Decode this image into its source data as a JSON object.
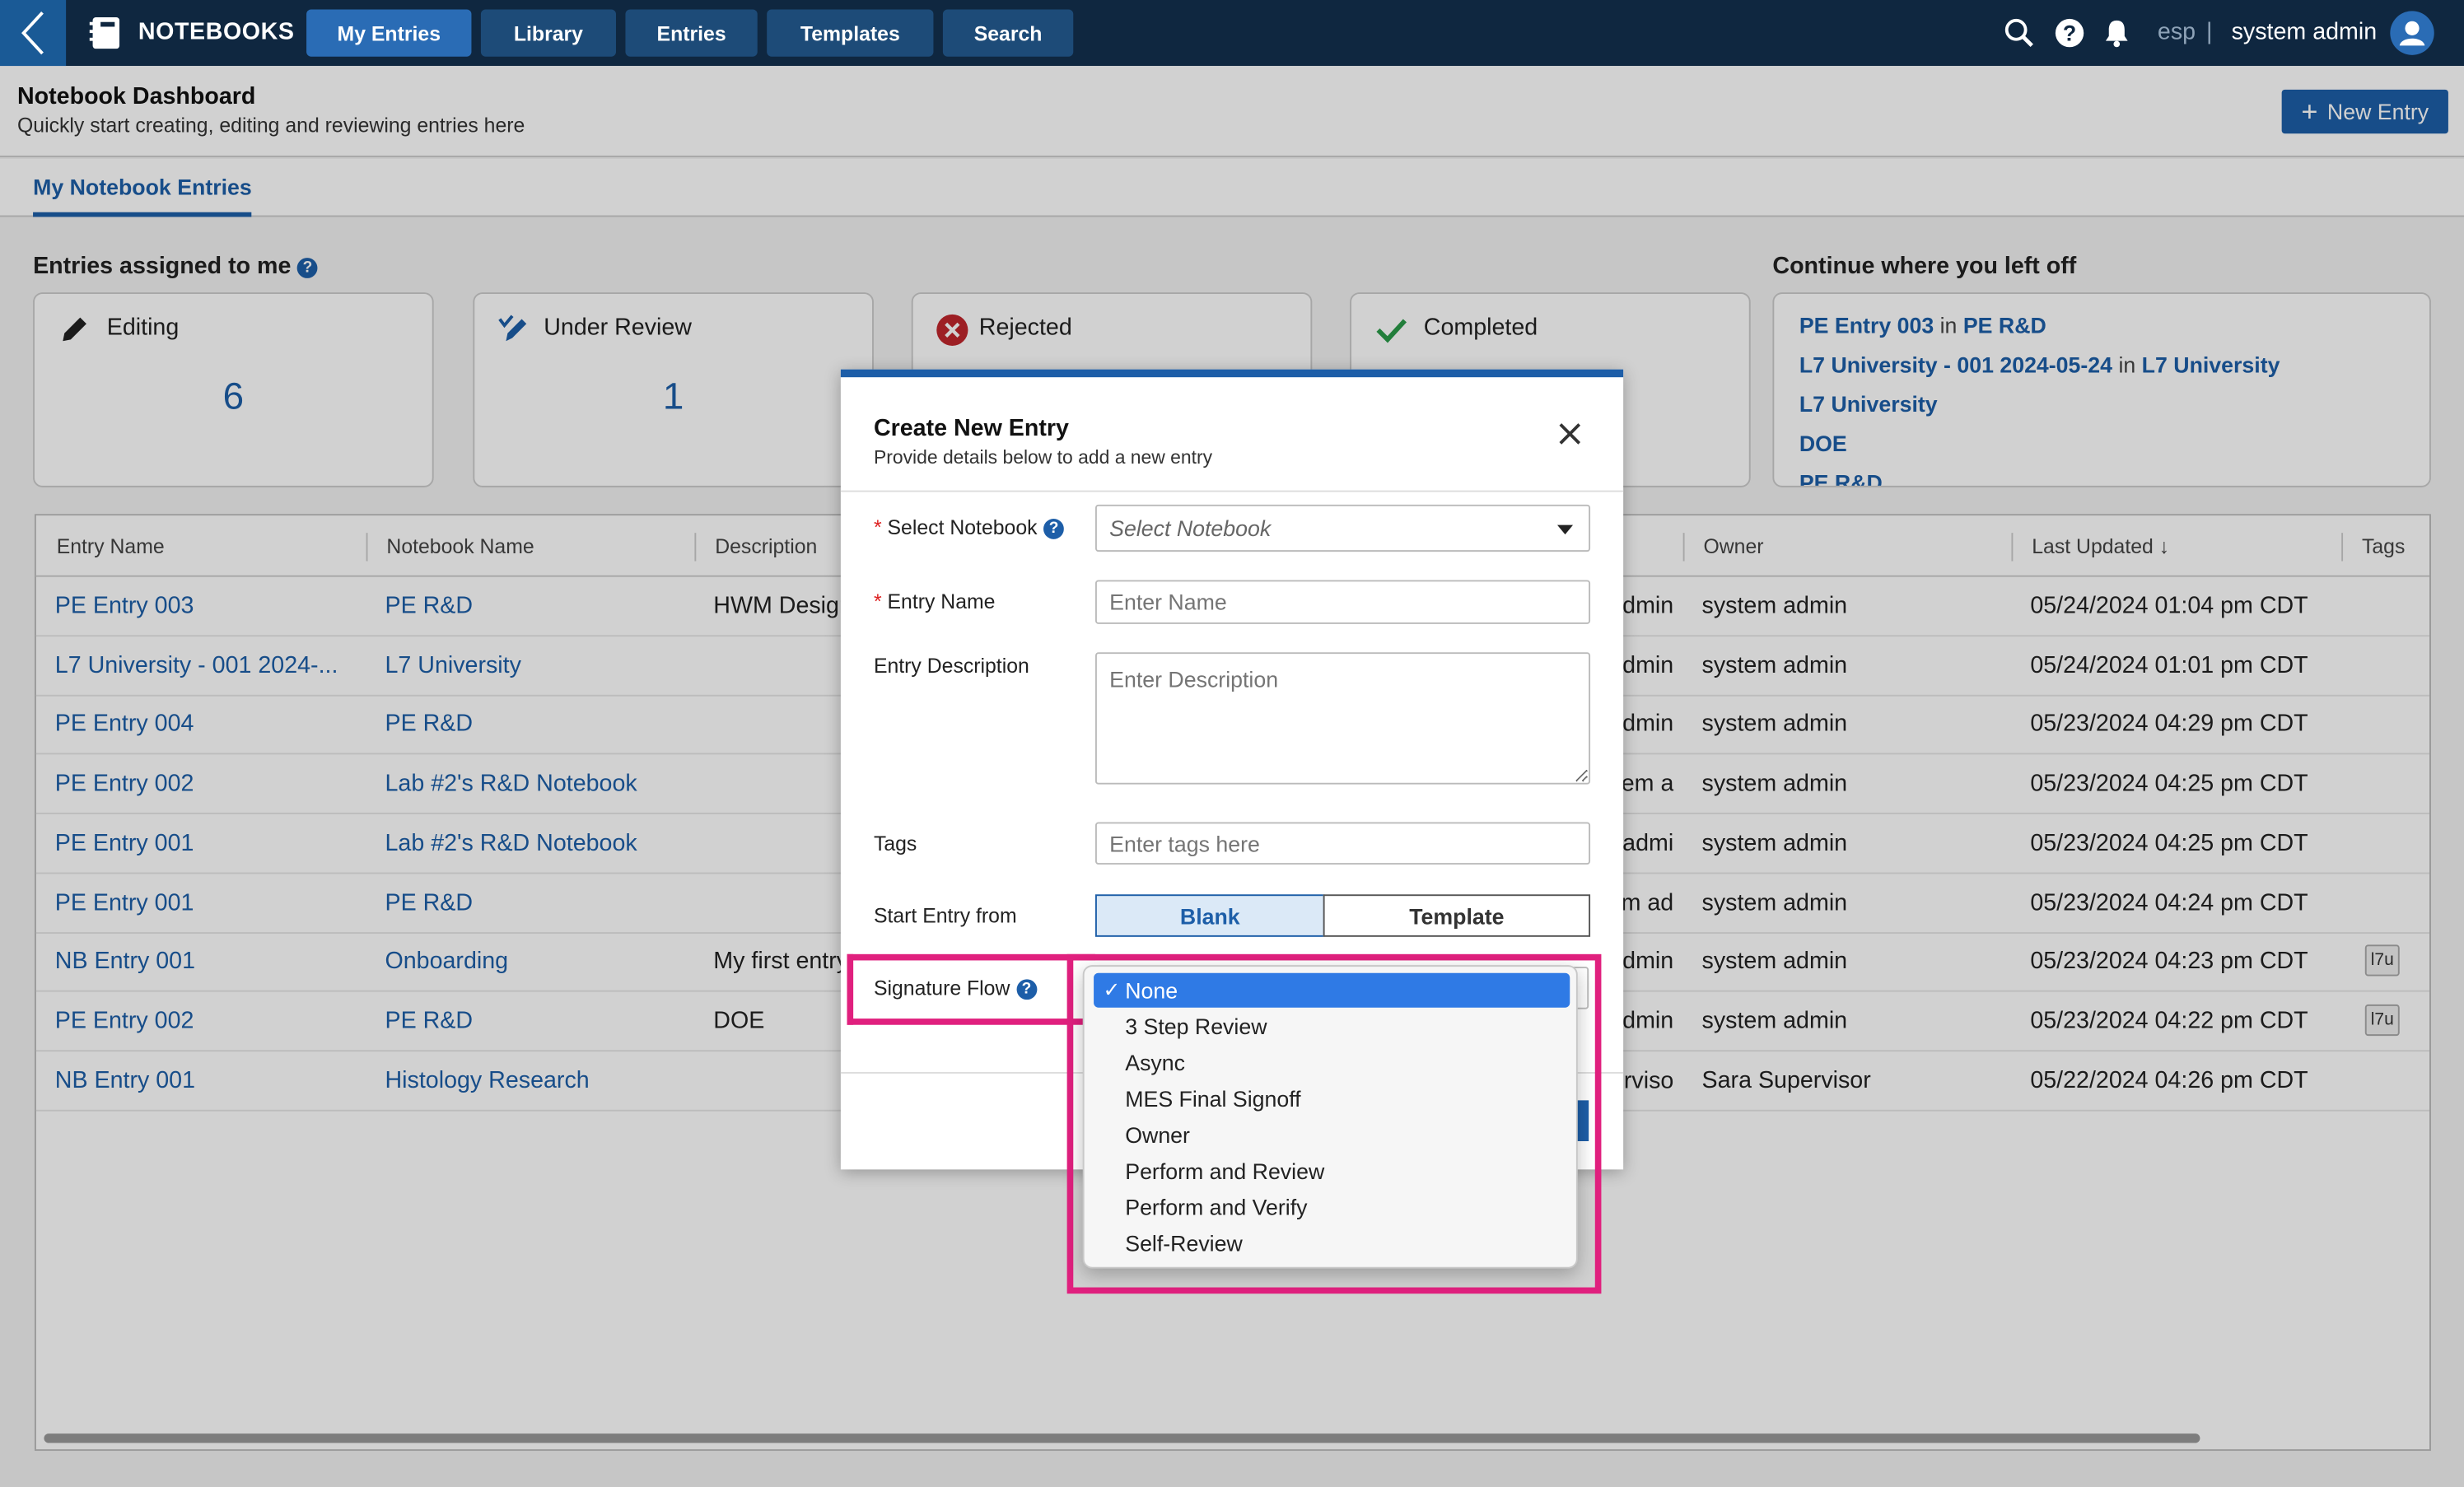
{
  "topnav": {
    "brand": "NOTEBOOKS",
    "tabs": [
      "My Entries",
      "Library",
      "Entries",
      "Templates",
      "Search"
    ],
    "active_tab": "My Entries",
    "lang": "esp",
    "separator": "|",
    "user": "system admin"
  },
  "page": {
    "title": "Notebook Dashboard",
    "subtitle": "Quickly start creating, editing and reviewing entries here",
    "new_entry_label": "New Entry"
  },
  "tabbar": {
    "active": "My Notebook Entries"
  },
  "assigned": {
    "heading": "Entries assigned to me",
    "help": "?",
    "cards": [
      {
        "label": "Editing",
        "count": "6",
        "icon": "pencil-icon"
      },
      {
        "label": "Under Review",
        "count": "1",
        "icon": "review-pencil-icon"
      },
      {
        "label": "Rejected",
        "count": "",
        "icon": "rejected-x-icon"
      },
      {
        "label": "Completed",
        "count": "",
        "icon": "checkmark-icon"
      }
    ]
  },
  "continue": {
    "heading": "Continue where you left off",
    "items": [
      {
        "link": "PE Entry 003",
        "in": "in",
        "notebook": "PE R&D"
      },
      {
        "link": "L7 University - 001 2024-05-24",
        "in": "in",
        "notebook": "L7 University"
      },
      {
        "link": "L7 University"
      },
      {
        "link": "DOE"
      },
      {
        "link": "PE R&D"
      }
    ]
  },
  "table": {
    "columns": {
      "entry_name": "Entry Name",
      "notebook_name": "Notebook Name",
      "description": "Description",
      "owner": "Owner",
      "last_updated": "Last Updated",
      "tags": "Tags"
    },
    "sort_indicator": "↓",
    "rows": [
      {
        "entry": "PE Entry 003",
        "notebook": "PE R&D",
        "description": "HWM Design",
        "status_peek": "dmin",
        "owner": "system admin",
        "updated": "05/24/2024 01:04 pm CDT",
        "tag": ""
      },
      {
        "entry": "L7 University - 001 2024-...",
        "notebook": "L7 University",
        "description": "",
        "status_peek": "dmin",
        "owner": "system admin",
        "updated": "05/24/2024 01:01 pm CDT",
        "tag": ""
      },
      {
        "entry": "PE Entry 004",
        "notebook": "PE R&D",
        "description": "",
        "status_peek": "dmin",
        "owner": "system admin",
        "updated": "05/23/2024 04:29 pm CDT",
        "tag": ""
      },
      {
        "entry": "PE Entry 002",
        "notebook": "Lab #2's R&D Notebook",
        "description": "",
        "status_peek": "stem a",
        "owner": "system admin",
        "updated": "05/23/2024 04:25 pm CDT",
        "tag": ""
      },
      {
        "entry": "PE Entry 001",
        "notebook": "Lab #2's R&D Notebook",
        "description": "",
        "status_peek": "admi",
        "owner": "system admin",
        "updated": "05/23/2024 04:25 pm CDT",
        "tag": ""
      },
      {
        "entry": "PE Entry 001",
        "notebook": "PE R&D",
        "description": "",
        "status_peek": "em ad",
        "owner": "system admin",
        "updated": "05/23/2024 04:24 pm CDT",
        "tag": ""
      },
      {
        "entry": "NB Entry 001",
        "notebook": "Onboarding",
        "description": "My first entry",
        "status_peek": "dmin",
        "owner": "system admin",
        "updated": "05/23/2024 04:23 pm CDT",
        "tag": "l7u"
      },
      {
        "entry": "PE Entry 002",
        "notebook": "PE R&D",
        "description": "DOE",
        "status_peek": "dmin",
        "owner": "system admin",
        "updated": "05/23/2024 04:22 pm CDT",
        "tag": "l7u"
      },
      {
        "entry": "NB Entry 001",
        "notebook": "Histology Research",
        "description": "",
        "status_peek": "erviso",
        "owner": "Sara Supervisor",
        "updated": "05/22/2024 04:26 pm CDT",
        "tag": ""
      }
    ]
  },
  "modal": {
    "title": "Create New Entry",
    "subtitle": "Provide details below to add a new entry",
    "required_mark": "*",
    "fields": {
      "notebook_label": "Select Notebook",
      "notebook_placeholder": "Select Notebook",
      "name_label": "Entry Name",
      "name_placeholder": "Enter Name",
      "description_label": "Entry Description",
      "description_placeholder": "Enter Description",
      "tags_label": "Tags",
      "tags_placeholder": "Enter tags here",
      "start_label": "Start Entry from",
      "start_options": [
        "Blank",
        "Template"
      ],
      "start_selected": "Blank",
      "signature_label": "Signature Flow"
    },
    "signature_options": [
      "None",
      "3 Step Review",
      "Async",
      "MES Final Signoff",
      "Owner",
      "Perform and Review",
      "Perform and Verify",
      "Self-Review"
    ],
    "signature_selected": "None",
    "check_mark": "✓"
  },
  "colors": {
    "nav_bg": "#0f2740",
    "accent": "#1d5ea8",
    "highlight": "#e0207e",
    "selected_option": "#2f7ae5"
  }
}
